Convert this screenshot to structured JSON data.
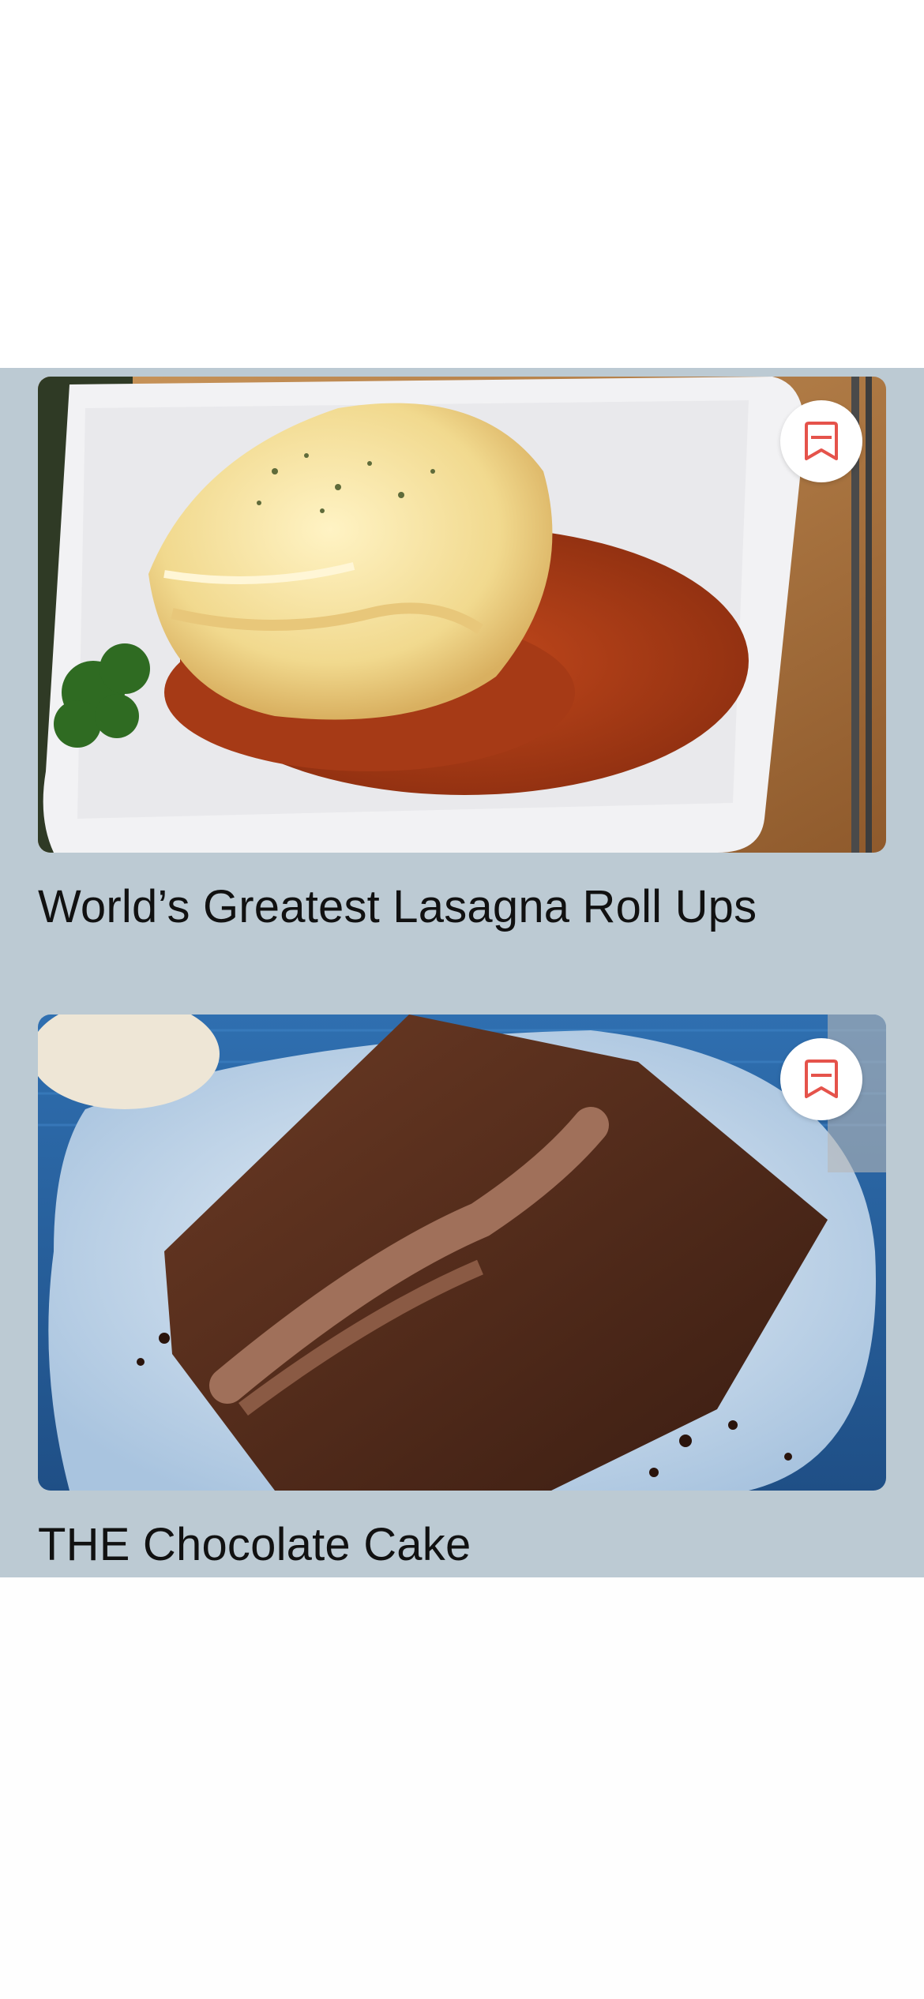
{
  "recipes": [
    {
      "title": "World’s Greatest Lasagna Roll Ups",
      "image": "lasagna-roll-ups-photo",
      "bookmark_icon": "bookmark-icon"
    },
    {
      "title": "THE Chocolate Cake",
      "image": "chocolate-cake-photo",
      "bookmark_icon": "bookmark-icon"
    }
  ],
  "colors": {
    "feed_background": "#bccad3",
    "bookmark_accent": "#e5534b",
    "title_text": "#111111"
  }
}
